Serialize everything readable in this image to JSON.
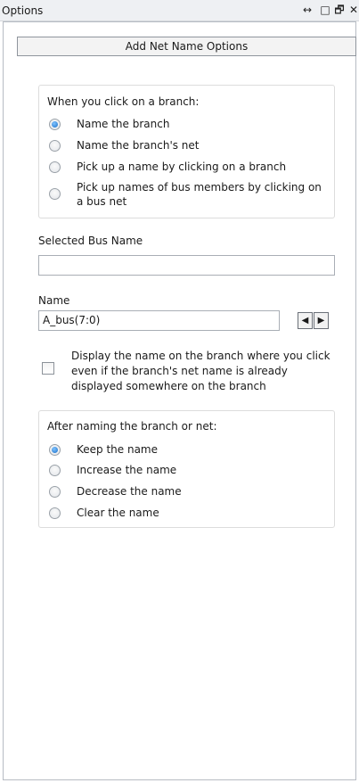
{
  "window": {
    "title": "Options",
    "controls": [
      "↔",
      "□",
      "🗗",
      "✕"
    ]
  },
  "header": {
    "button_label": "Add Net Name Options"
  },
  "branch_click": {
    "label": "When you click on a branch:",
    "options": [
      {
        "label": "Name the branch",
        "selected": true
      },
      {
        "label": "Name the branch's net",
        "selected": false
      },
      {
        "label": "Pick up a name by clicking on a branch",
        "selected": false
      },
      {
        "label_line1": "Pick up names of bus members by clicking on",
        "label_line2": "a bus net",
        "selected": false
      }
    ]
  },
  "selected_bus": {
    "label": "Selected Bus Name",
    "value": ""
  },
  "name": {
    "label": "Name",
    "value": "A_bus(7:0)",
    "prev": "◀",
    "next": "▶"
  },
  "display_option": {
    "line1": "Display the name on the branch where you click",
    "line2": "even if the branch's net name is already",
    "line3": "displayed somewhere on the branch",
    "checked": false
  },
  "after_naming": {
    "label": "After naming the branch or net:",
    "options": [
      {
        "label": "Keep the name",
        "selected": true
      },
      {
        "label": "Increase the name",
        "selected": false
      },
      {
        "label": "Decrease the name",
        "selected": false
      },
      {
        "label": "Clear the name",
        "selected": false
      }
    ]
  }
}
